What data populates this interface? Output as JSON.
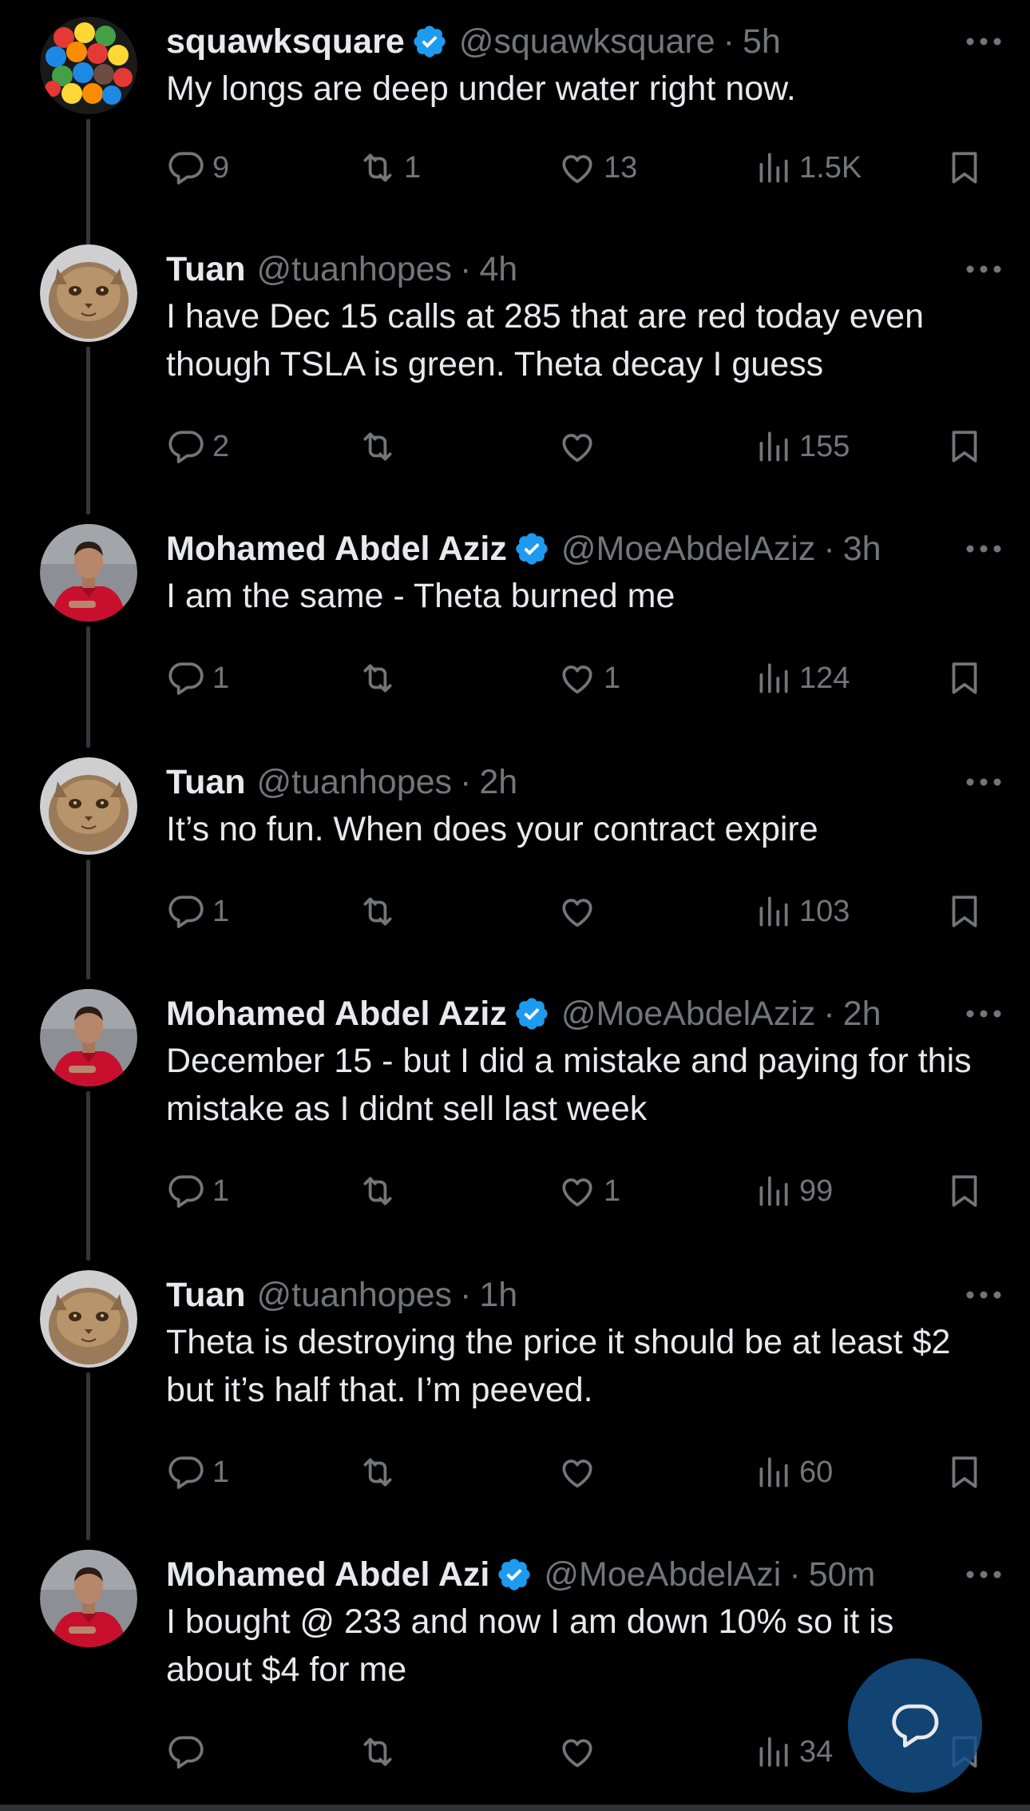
{
  "tweets": [
    {
      "display_name": "squawksquare",
      "verified": true,
      "handle": "@squawksquare",
      "time": "5h",
      "text": "My longs are deep under water right now.",
      "replies": "9",
      "reposts": "1",
      "likes": "13",
      "views": "1.5K",
      "avatar": "candy-avatar"
    },
    {
      "display_name": "Tuan",
      "verified": false,
      "handle": "@tuanhopes",
      "time": "4h",
      "text": "I have Dec 15 calls at 285 that are red today even though TSLA is green. Theta decay I guess",
      "replies": "2",
      "reposts": "",
      "likes": "",
      "views": "155",
      "avatar": "cat-avatar"
    },
    {
      "display_name": "Mohamed Abdel Aziz",
      "verified": true,
      "handle": "@MoeAbdelAziz",
      "time": "3h",
      "text": "I am the same - Theta burned me",
      "replies": "1",
      "reposts": "",
      "likes": "1",
      "views": "124",
      "avatar": "person-avatar"
    },
    {
      "display_name": "Tuan",
      "verified": false,
      "handle": "@tuanhopes",
      "time": "2h",
      "text": "It’s no fun. When does your contract expire",
      "replies": "1",
      "reposts": "",
      "likes": "",
      "views": "103",
      "avatar": "cat-avatar"
    },
    {
      "display_name": "Mohamed Abdel Aziz",
      "verified": true,
      "handle": "@MoeAbdelAziz",
      "time": "2h",
      "text": "December 15 - but I did a mistake and paying for this mistake as I didnt sell last week",
      "replies": "1",
      "reposts": "",
      "likes": "1",
      "views": "99",
      "avatar": "person-avatar"
    },
    {
      "display_name": "Tuan",
      "verified": false,
      "handle": "@tuanhopes",
      "time": "1h",
      "text": "Theta is destroying the price it should be at least $2 but it’s half that. I’m peeved.",
      "replies": "1",
      "reposts": "",
      "likes": "",
      "views": "60",
      "avatar": "cat-avatar"
    },
    {
      "display_name": "Mohamed Abdel Azi",
      "verified": true,
      "handle": "@MoeAbdelAzi",
      "time": "50m",
      "text": "I bought @ 233 and now I am down 10% so it is about $4 for me",
      "replies": "",
      "reposts": "",
      "likes": "",
      "views": "34",
      "avatar": "person-avatar"
    }
  ],
  "compose_button": {
    "icon": "compose-reply-icon"
  },
  "colors": {
    "background": "#000000",
    "text_primary": "#e7e9ea",
    "text_secondary": "#71767b",
    "verified_badge": "#1d9bf0",
    "thread_line": "#333639",
    "fab": "#15528c"
  }
}
